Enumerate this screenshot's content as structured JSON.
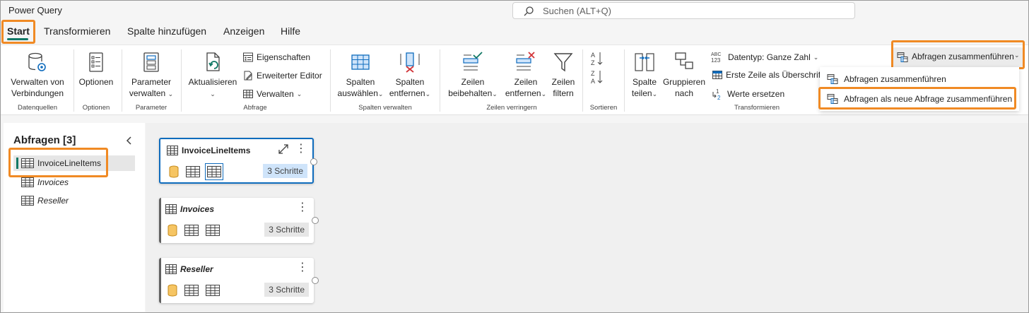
{
  "app": {
    "title": "Power Query"
  },
  "search": {
    "placeholder": "Suchen (ALT+Q)"
  },
  "tabs": [
    {
      "label": "Start",
      "active": true
    },
    {
      "label": "Transformieren"
    },
    {
      "label": "Spalte hinzufügen"
    },
    {
      "label": "Anzeigen"
    },
    {
      "label": "Hilfe"
    }
  ],
  "ribbon": {
    "datenquellen": {
      "group": "Datenquellen",
      "manage": "Verwalten von\nVerbindungen"
    },
    "optionen": {
      "group": "Optionen",
      "btn": "Optionen"
    },
    "parameter": {
      "group": "Parameter",
      "btn1": "Parameter",
      "btn2": "verwalten"
    },
    "abfrage": {
      "group": "Abfrage",
      "refresh": "Aktualisieren",
      "props": "Eigenschaften",
      "editor": "Erweiterter Editor",
      "manage": "Verwalten"
    },
    "spalten": {
      "group": "Spalten verwalten",
      "choose1": "Spalten",
      "choose2": "auswählen",
      "remove1": "Spalten",
      "remove2": "entfernen"
    },
    "zeilen": {
      "group": "Zeilen verringern",
      "keep1": "Zeilen",
      "keep2": "beibehalten",
      "rem1": "Zeilen",
      "rem2": "entfernen",
      "filter1": "Zeilen",
      "filter2": "filtern"
    },
    "sortieren": {
      "group": "Sortieren"
    },
    "transformieren": {
      "group": "Transformieren",
      "split1": "Spalte",
      "split2": "teilen",
      "group1": "Gruppieren",
      "group2": "nach",
      "datatype": "Datentyp: Ganze Zahl",
      "firstrow": "Erste Zeile als Überschrif",
      "replace": "Werte ersetzen"
    },
    "merge": {
      "button": "Abfragen zusammenführen",
      "menu": [
        "Abfragen zusammenführen",
        "Abfragen als neue Abfrage zusammenführen"
      ]
    }
  },
  "queries": {
    "title": "Abfragen [3]",
    "items": [
      "InvoiceLineItems",
      "Invoices",
      "Reseller"
    ]
  },
  "cards": [
    {
      "title": "InvoiceLineItems",
      "steps": "3 Schritte"
    },
    {
      "title": "Invoices",
      "steps": "3 Schritte"
    },
    {
      "title": "Reseller",
      "steps": "3 Schritte"
    }
  ],
  "colors": {
    "accent": "#117865",
    "highlight": "#f08a24",
    "selection": "#0f6cbd"
  }
}
